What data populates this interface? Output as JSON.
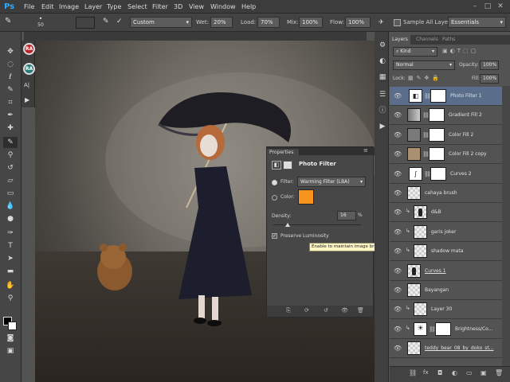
{
  "app": {
    "logo": "Ps"
  },
  "menu": [
    "File",
    "Edit",
    "Image",
    "Layer",
    "Type",
    "Select",
    "Filter",
    "3D",
    "View",
    "Window",
    "Help"
  ],
  "window_controls": [
    "–",
    "□",
    "✕"
  ],
  "options": {
    "brush_size": "50",
    "preset": "Custom",
    "wet_label": "Wet:",
    "wet_value": "20%",
    "load_label": "Load:",
    "load_value": "70%",
    "mix_label": "Mix:",
    "mix_value": "100%",
    "flow_label": "Flow:",
    "flow_value": "100%",
    "sample_all_layers": "Sample All Layers",
    "workspace": "Essentials"
  },
  "secondary_panel": [
    "RA",
    "RA",
    "A|",
    "▶"
  ],
  "layers_panel": {
    "tabs": [
      "Layers",
      "Channels",
      "Paths"
    ],
    "kind": "Kind",
    "blend_mode": "Normal",
    "opacity_label": "Opacity:",
    "opacity_value": "100%",
    "lock_label": "Lock:",
    "fill_label": "Fill:",
    "fill_value": "100%",
    "layers": [
      {
        "name": "Photo Filter 1",
        "selected": true,
        "thumb": "adjust",
        "mask": true,
        "clip": false,
        "thumbcolor": "#ffffff"
      },
      {
        "name": "Gradient Fill 2",
        "selected": false,
        "thumb": "gradient",
        "mask": true,
        "clip": false,
        "thumbcolor": "#aaaaaa"
      },
      {
        "name": "Color Fill 2",
        "selected": false,
        "thumb": "solid",
        "mask": true,
        "clip": false,
        "thumbcolor": "#7a7a7a"
      },
      {
        "name": "Color Fill 2 copy",
        "selected": false,
        "thumb": "solid",
        "mask": true,
        "clip": false,
        "thumbcolor": "#a89070"
      },
      {
        "name": "Curves 2",
        "selected": false,
        "thumb": "curves",
        "mask": true,
        "clip": false,
        "thumbcolor": "#ffffff"
      },
      {
        "name": "cahaya brush",
        "selected": false,
        "thumb": "checker",
        "mask": false,
        "clip": false,
        "thumbcolor": ""
      },
      {
        "name": "d&B",
        "selected": false,
        "thumb": "figure",
        "mask": false,
        "clip": true,
        "thumbcolor": ""
      },
      {
        "name": "garis joker",
        "selected": false,
        "thumb": "checker",
        "mask": false,
        "clip": true,
        "thumbcolor": ""
      },
      {
        "name": "shadow mata",
        "selected": false,
        "thumb": "checker",
        "mask": false,
        "clip": true,
        "thumbcolor": ""
      },
      {
        "name": "Curves 1",
        "selected": false,
        "thumb": "figure",
        "mask": false,
        "clip": false,
        "thumbcolor": "",
        "underline": true
      },
      {
        "name": "Bayangan",
        "selected": false,
        "thumb": "checker",
        "mask": false,
        "clip": false,
        "thumbcolor": ""
      },
      {
        "name": "Layer 30",
        "selected": false,
        "thumb": "checker",
        "mask": false,
        "clip": true,
        "thumbcolor": ""
      },
      {
        "name": "Brightness/Co...",
        "selected": false,
        "thumb": "sun",
        "mask": true,
        "clip": true,
        "thumbcolor": "#ffffff"
      },
      {
        "name": "teddy_bear_08_by_doko_st...",
        "selected": false,
        "thumb": "checker",
        "mask": false,
        "clip": false,
        "thumbcolor": "",
        "underline": true
      }
    ],
    "footer_icons": [
      "link-icon",
      "fx-icon",
      "mask-icon",
      "adjustment-icon",
      "folder-icon",
      "new-layer-icon",
      "trash-icon"
    ]
  },
  "properties": {
    "title": "Properties",
    "panel_title": "Photo Filter",
    "filter_label": "Filter:",
    "filter_value": "Warming Filter (LBA)",
    "color_label": "Color:",
    "color_swatch": "#f7941d",
    "density_label": "Density:",
    "density_value": "16",
    "density_unit": "%",
    "density_fraction": 0.16,
    "preserve_label": "Preserve Luminosity",
    "preserve_checked": true
  },
  "tooltip": "Enable to maintain image brightness",
  "colors": {
    "accent_select": "#5a6d8a",
    "panel_bg": "#535353",
    "ps_blue": "#31a8ff"
  }
}
